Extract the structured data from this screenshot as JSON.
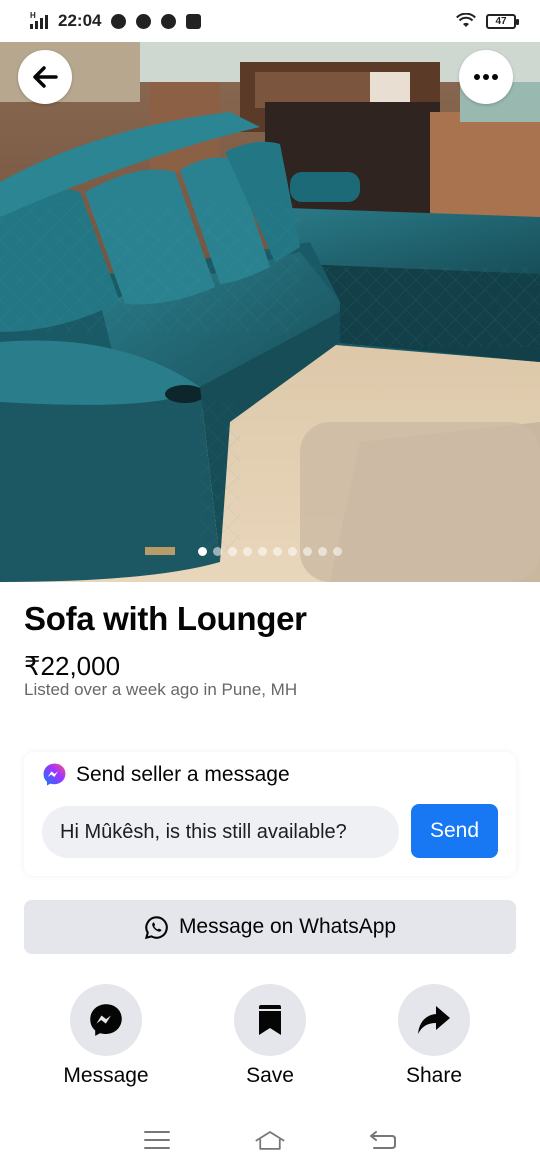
{
  "status_bar": {
    "network": "H",
    "time": "22:04",
    "battery": "47"
  },
  "listing": {
    "title": "Sofa with Lounger",
    "price": "₹22,000",
    "listed": "Listed over a week ago in Pune, MH",
    "image_count": 10,
    "active_image_index": 0
  },
  "message_card": {
    "heading": "Send seller a message",
    "input_value": "Hi Mûkêsh, is this still available?",
    "send_label": "Send"
  },
  "whatsapp": {
    "label": "Message on WhatsApp"
  },
  "actions": [
    {
      "label": "Message",
      "icon": "messenger-icon"
    },
    {
      "label": "Save",
      "icon": "bookmark-icon"
    },
    {
      "label": "Share",
      "icon": "share-arrow-icon"
    }
  ],
  "colors": {
    "accent": "#1877f2",
    "button_bg": "#e4e6eb",
    "secondary_text": "#65676b",
    "sofa": "#1f6470"
  },
  "nav": {
    "icons": [
      "menu-icon",
      "home-icon",
      "back-icon"
    ]
  }
}
